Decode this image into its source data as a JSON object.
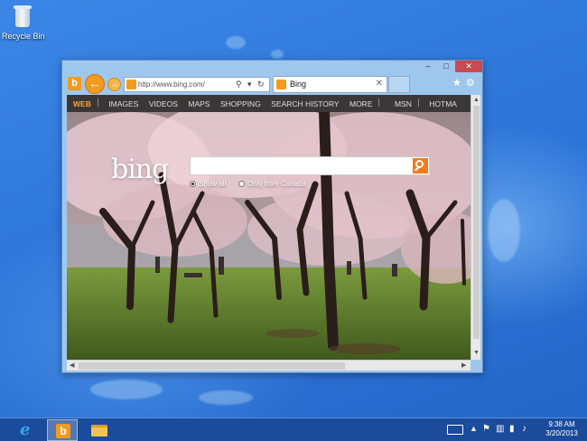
{
  "desktop": {
    "recycle_bin_label": "Recycle Bin"
  },
  "browser": {
    "window_controls": {
      "minimize": "–",
      "maximize": "□",
      "close": "✕"
    },
    "address": {
      "value": "http://www.bing.com/",
      "search_glyph": "⚲",
      "dropdown_glyph": "▾",
      "refresh_glyph": "↻"
    },
    "tab": {
      "title": "Bing",
      "close_glyph": "✕"
    },
    "favorites_glyph": "★",
    "tools_glyph": "⚙",
    "back_glyph": "←",
    "forward_glyph": "→",
    "bing_nav": [
      "WEB",
      "IMAGES",
      "VIDEOS",
      "MAPS",
      "SHOPPING",
      "SEARCH HISTORY",
      "MORE",
      "MSN",
      "HOTMA"
    ],
    "bing": {
      "logo_text": "bing",
      "search_value": "",
      "option_all": "Show all",
      "option_canada": "Only from Canada"
    },
    "scroll": {
      "up": "▲",
      "down": "▼",
      "left": "◀",
      "right": "▶"
    }
  },
  "taskbar": {
    "ie_glyph": "e",
    "bing_glyph": "b",
    "clock_time": "9:38 AM",
    "clock_date": "3/20/2013"
  },
  "colors": {
    "bing_orange": "#f29b1d",
    "close_red": "#c74b50",
    "desktop_blue": "#2f78dc"
  }
}
